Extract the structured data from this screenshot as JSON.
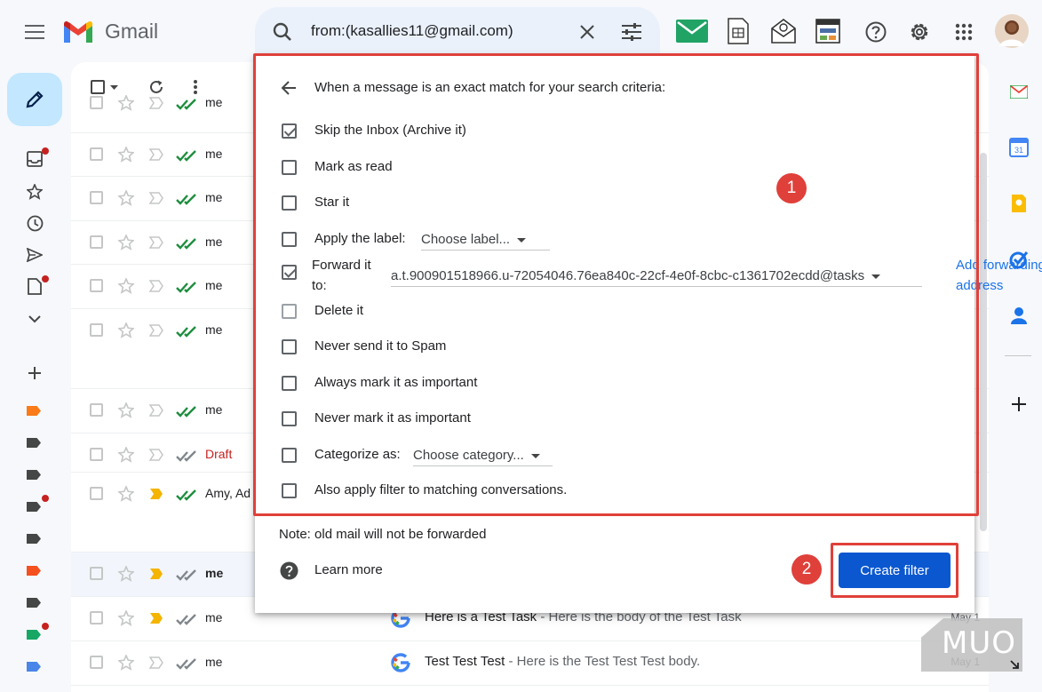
{
  "app": {
    "name": "Gmail"
  },
  "search": {
    "query": "from:(kasallies11@gmail.com)"
  },
  "filter_dialog": {
    "header": "When a message is an exact match for your search criteria:",
    "options": [
      {
        "label": "Skip the Inbox (Archive it)",
        "checked": true
      },
      {
        "label": "Mark as read",
        "checked": false
      },
      {
        "label": "Star it",
        "checked": false
      },
      {
        "label": "Apply the label:",
        "checked": false
      },
      {
        "label": "Forward it to:",
        "checked": true
      },
      {
        "label": "Delete it",
        "checked": false
      },
      {
        "label": "Never send it to Spam",
        "checked": false
      },
      {
        "label": "Always mark it as important",
        "checked": false
      },
      {
        "label": "Never mark it as important",
        "checked": false
      },
      {
        "label": "Categorize as:",
        "checked": false
      },
      {
        "label": "Also apply filter to matching conversations.",
        "checked": false
      }
    ],
    "forward_label_line1": "Forward it",
    "forward_label_line2": "to:",
    "label_dropdown": "Choose label...",
    "forward_address": "a.t.900901518966.u-72054046.76ea840c-22cf-4e0f-8cbc-c1361702ecdd@tasks",
    "add_forwarding_line1": "Add forwarding",
    "add_forwarding_line2": "address",
    "category_dropdown": "Choose category...",
    "note": "Note: old mail will not be forwarded",
    "learn_more": "Learn more",
    "create_button": "Create filter"
  },
  "annotations": {
    "badge1": "1",
    "badge2": "2"
  },
  "email_rows": [
    {
      "sender": "me",
      "subject": "",
      "date": ""
    },
    {
      "sender": "me",
      "subject": "",
      "date": ""
    },
    {
      "sender": "me",
      "subject": "",
      "date": ""
    },
    {
      "sender": "me",
      "subject": "",
      "date": ""
    },
    {
      "sender": "me",
      "subject": "",
      "date": ""
    },
    {
      "sender": "me",
      "subject": "",
      "date": ""
    },
    {
      "sender": "me",
      "subject": "",
      "date": ""
    },
    {
      "sender": "Draft",
      "subject": "",
      "date": ""
    },
    {
      "sender": "Amy, Ad",
      "subject": "",
      "date": ""
    },
    {
      "sender": "me",
      "subject": "",
      "date": ""
    },
    {
      "sender": "me",
      "subject": "Here is a Test Task",
      "snippet": " - Here is the body of the Test Task",
      "date": "May 1"
    },
    {
      "sender": "me",
      "subject": "Test Test Test",
      "snippet": " - Here is the Test Test Test body.",
      "date": "May 1"
    }
  ],
  "watermark": "MUO",
  "colors": {
    "accent": "#0b57d0",
    "annotation_red": "#e0403a",
    "compose_bg": "#c2e7ff",
    "draft_red": "#c5221f"
  }
}
